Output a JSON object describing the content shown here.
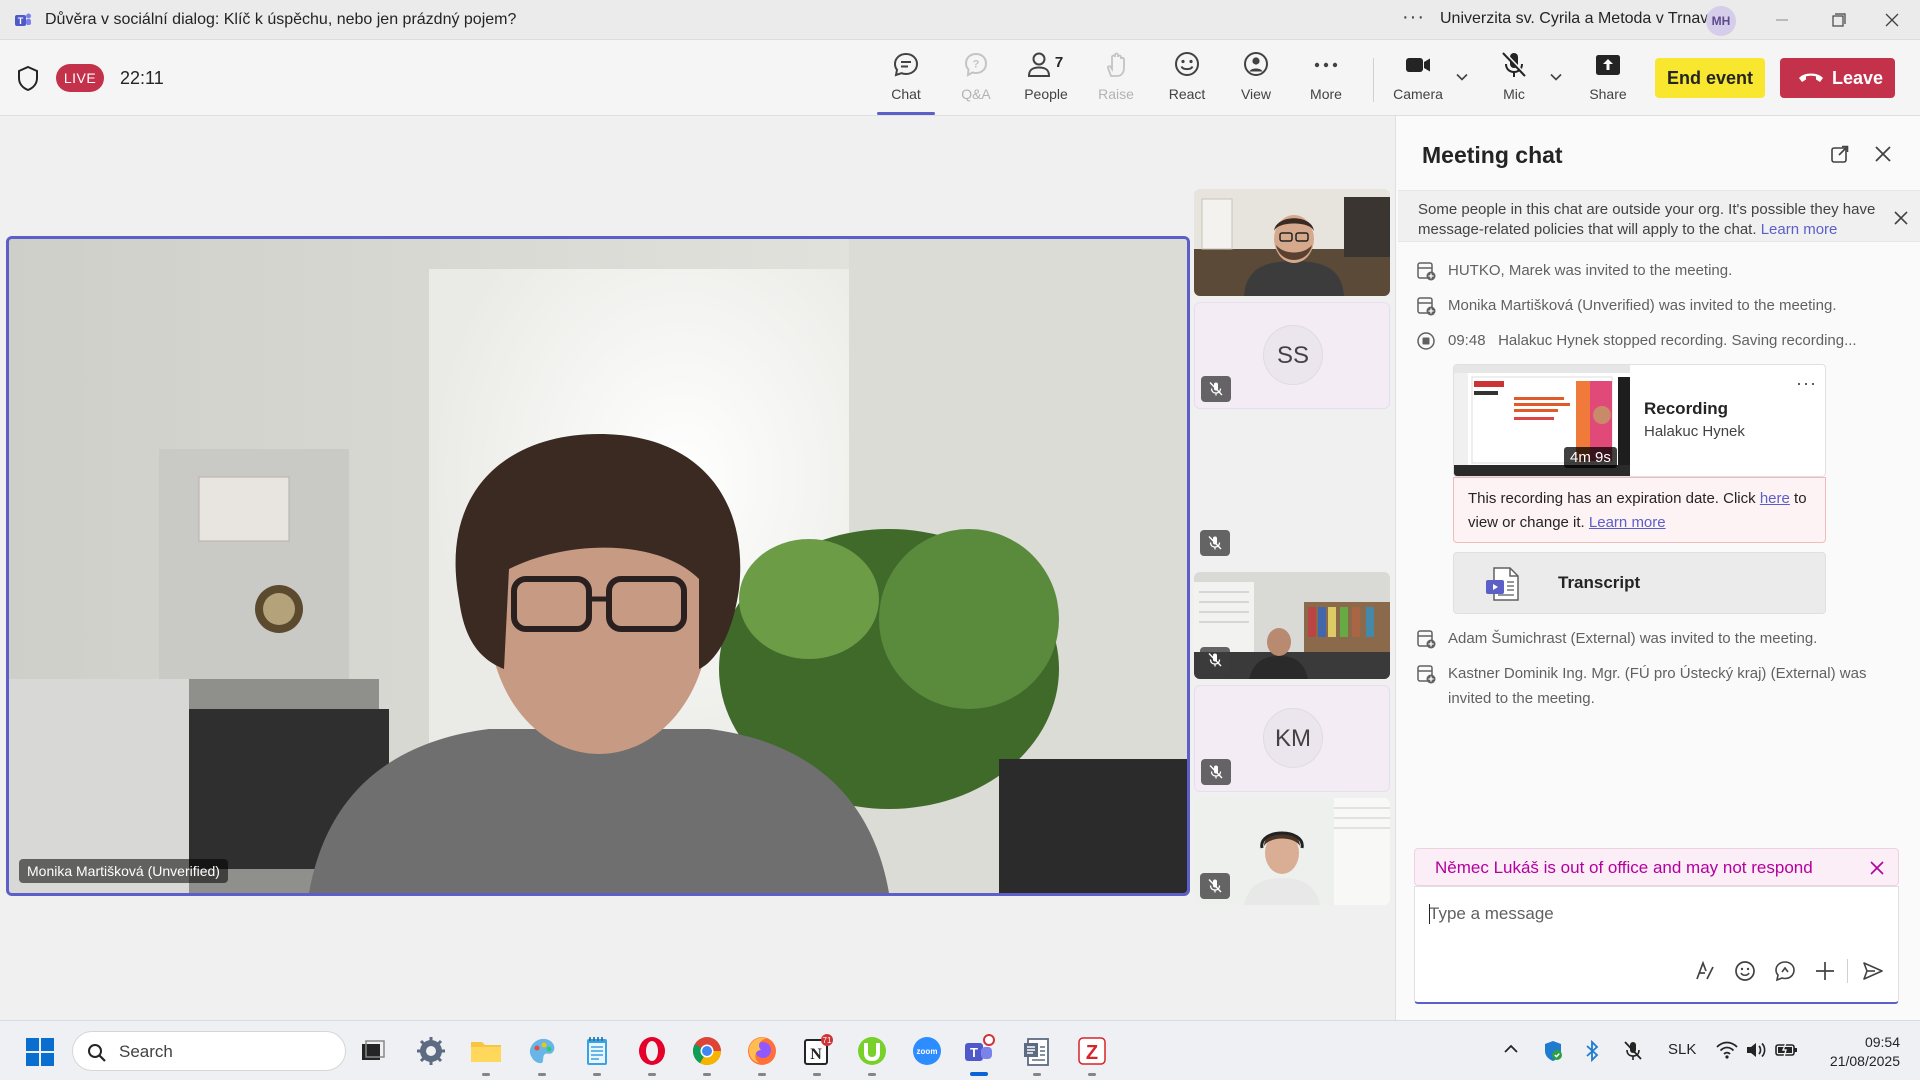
{
  "window": {
    "title": "Důvěra v sociální dialog: Klíč k úspěchu, nebo jen prázdný pojem?",
    "more_glyph": "···",
    "org_name": "Univerzita sv. Cyrila a Metoda v Trnave",
    "user_initials": "MH"
  },
  "meeting_bar": {
    "live_label": "LIVE",
    "elapsed": "22:11",
    "buttons": {
      "chat": "Chat",
      "qa": "Q&A",
      "people": "People",
      "people_count": "7",
      "raise": "Raise",
      "react": "React",
      "view": "View",
      "more": "More",
      "camera": "Camera",
      "mic": "Mic",
      "share": "Share"
    },
    "end_event": "End event",
    "leave": "Leave",
    "accent": "#5b5fc7",
    "leave_color": "#c4314b",
    "end_event_color": "#f8e62f"
  },
  "stage": {
    "main_participant": "Monika Martišková (Unverified)",
    "tiles": [
      {
        "type": "video",
        "muted": false
      },
      {
        "type": "avatar",
        "initials": "SS",
        "muted": true
      },
      {
        "type": "video",
        "muted": true
      },
      {
        "type": "avatar",
        "initials": "KM",
        "muted": true
      },
      {
        "type": "video",
        "muted": true
      }
    ]
  },
  "chat": {
    "title": "Meeting chat",
    "org_banner": {
      "text": "Some people in this chat are outside your org. It's possible they have message-related policies that will apply to the chat.",
      "link": "Learn more"
    },
    "events": [
      {
        "icon": "invite-icon",
        "time": "",
        "text": "HUTKO, Marek was invited to the meeting."
      },
      {
        "icon": "invite-icon",
        "time": "",
        "text": "Monika Martišková (Unverified) was invited to the meeting."
      },
      {
        "icon": "recording-stop-icon",
        "time": "09:48",
        "text": "Halakuc Hynek stopped recording. Saving recording..."
      }
    ],
    "recording": {
      "title": "Recording",
      "owner": "Halakuc Hynek",
      "duration": "4m 9s",
      "more": "···",
      "expiry_text_1": "This recording has an expiration date. Click",
      "expiry_link_here": "here",
      "expiry_text_2": "to view or change it.",
      "expiry_link_learn": "Learn more"
    },
    "transcript_label": "Transcript",
    "events_after": [
      {
        "icon": "invite-icon",
        "text": "Adam Šumichrast (External) was invited to the meeting."
      },
      {
        "icon": "invite-icon",
        "text": "Kastner Dominik Ing. Mgr. (FÚ pro Ústecký kraj) (External) was invited to the meeting."
      }
    ],
    "ooo_banner": "Němec Lukáš is out of office and may not respond",
    "ooo_color": "#b4009e",
    "compose_placeholder": "Type a message"
  },
  "taskbar": {
    "search_label": "Search",
    "notion_badge": "71",
    "apps": [
      "task-view-icon",
      "settings-icon",
      "file-explorer-icon",
      "paint-icon",
      "notepad-icon",
      "opera-icon",
      "chrome-icon",
      "firefox-icon",
      "notion-icon",
      "utorrent-icon",
      "zoom-icon",
      "teams-icon",
      "document-app-icon",
      "z-app-icon"
    ],
    "zoom_label": "zoom",
    "tray": {
      "language": "SLK",
      "time": "09:54",
      "date": "21/08/2025"
    }
  }
}
